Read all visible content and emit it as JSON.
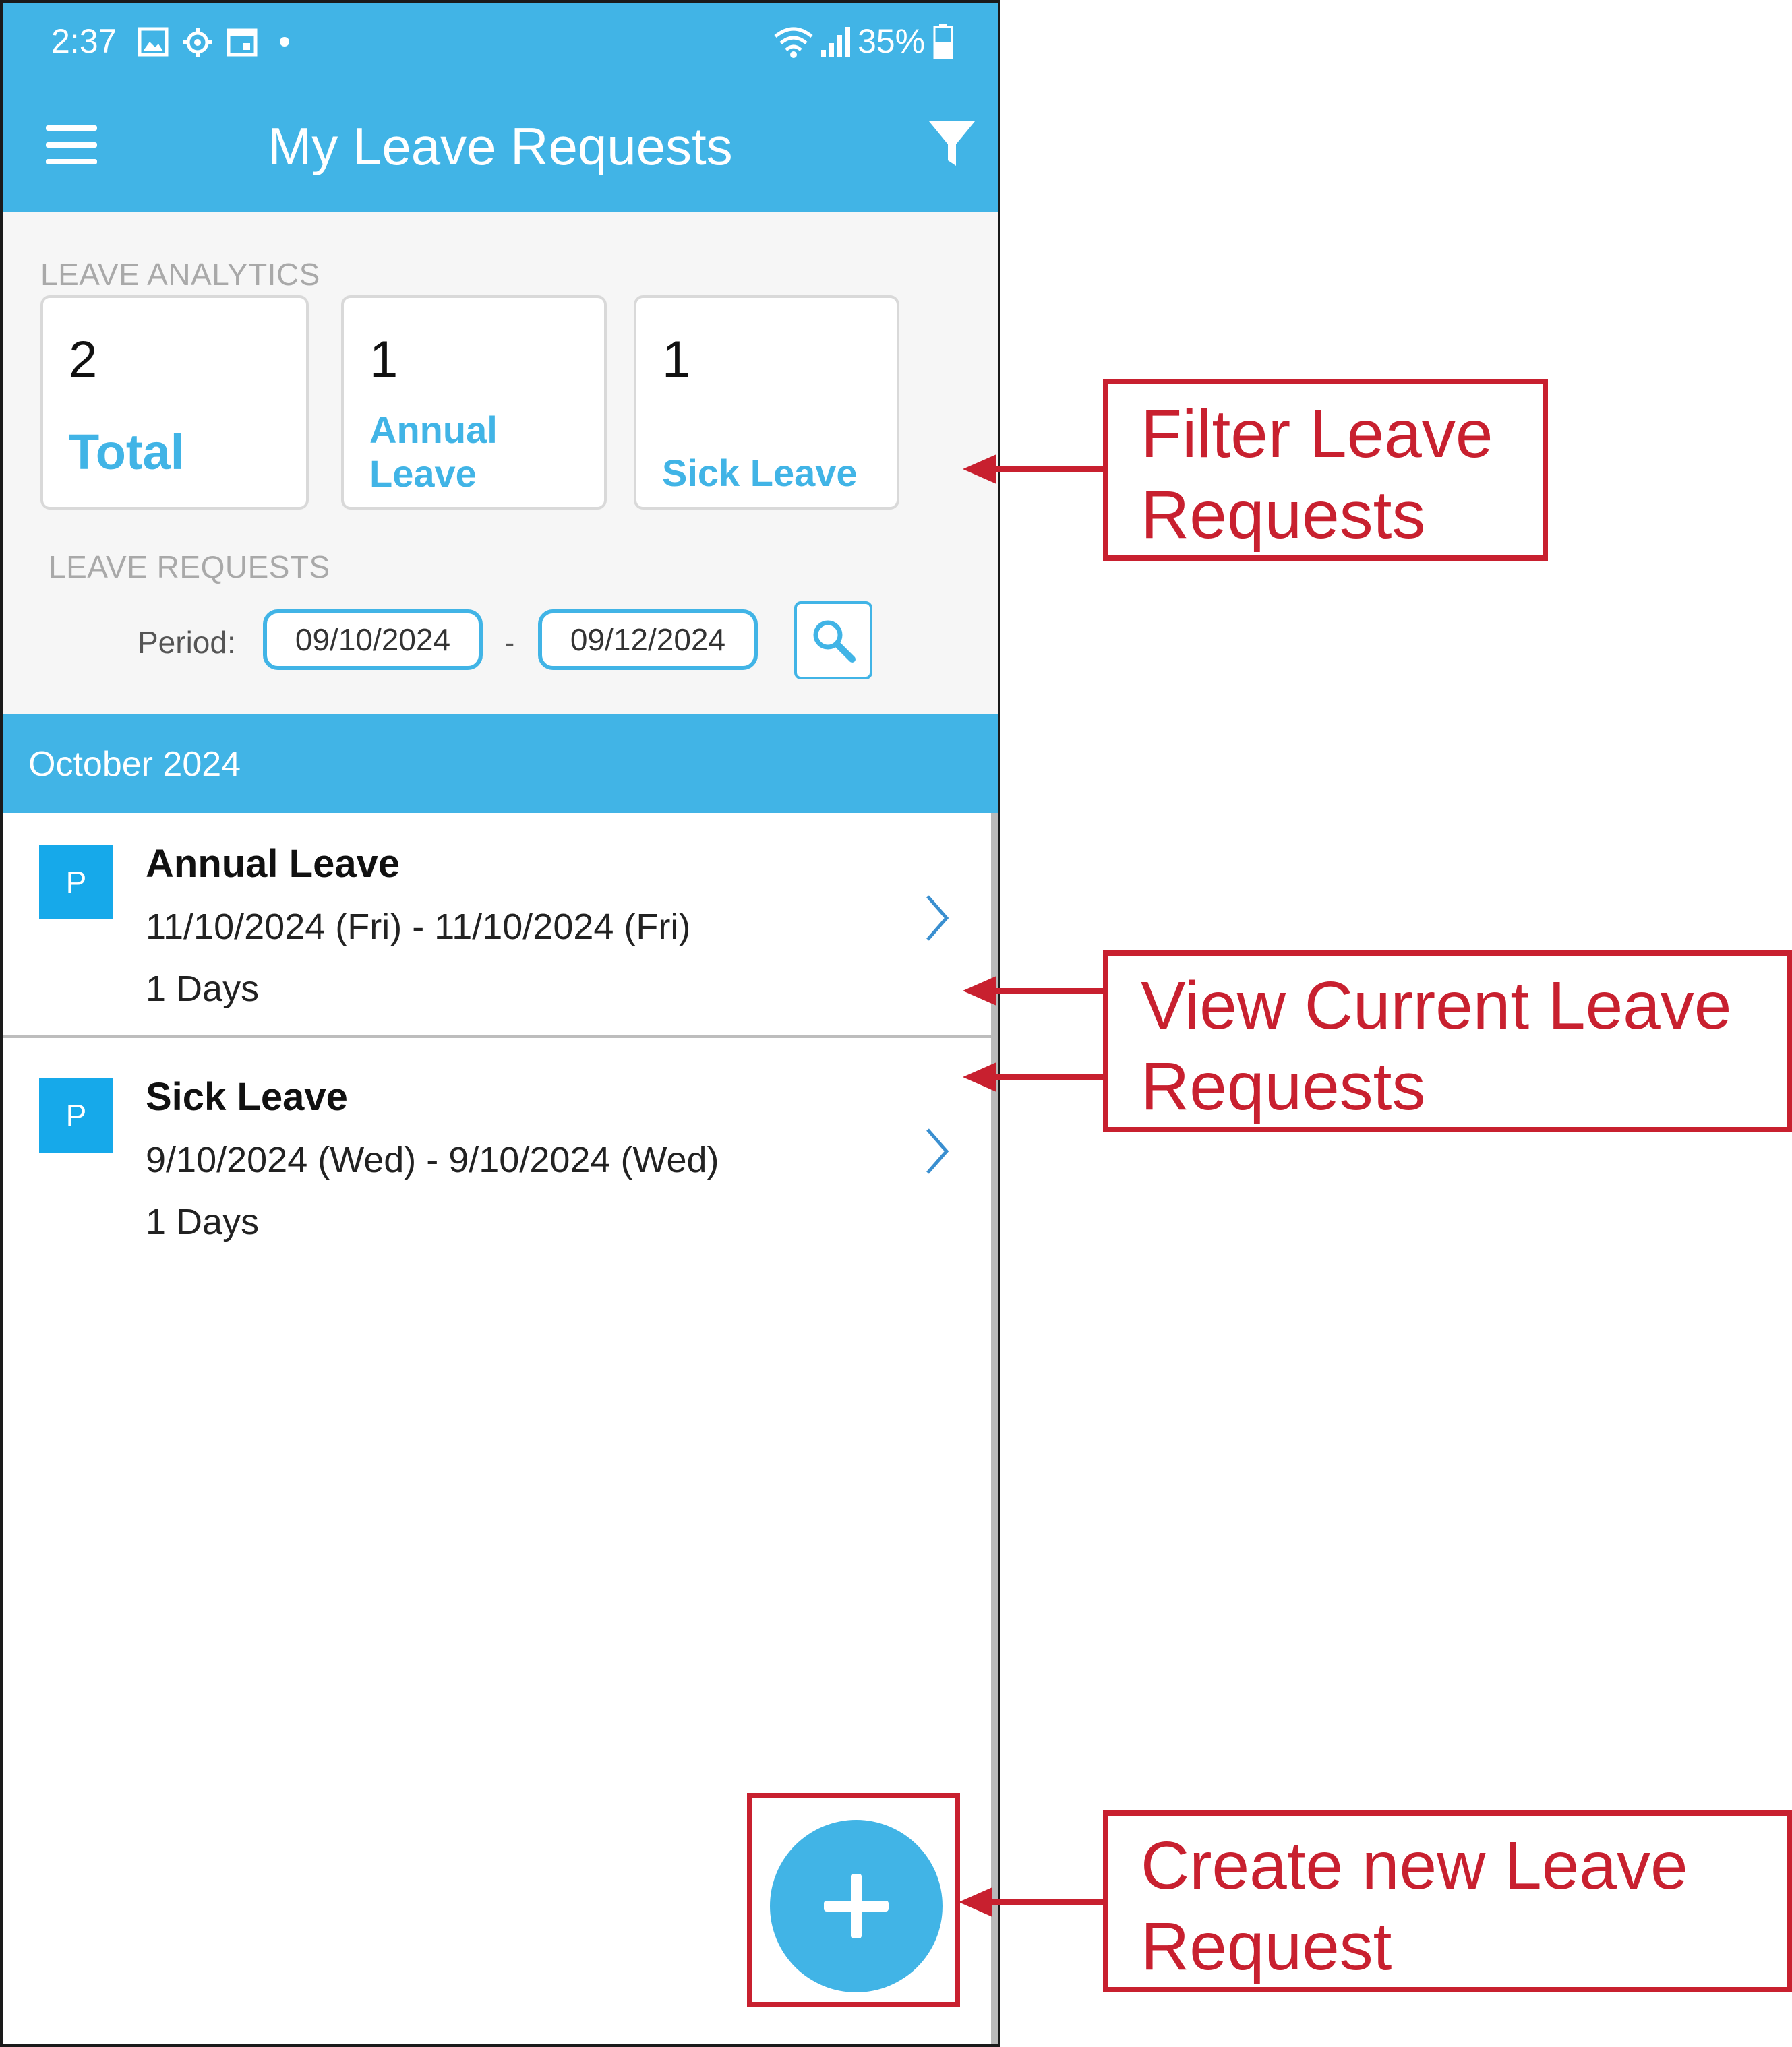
{
  "status_bar": {
    "time": "2:37",
    "battery_percent": "35%",
    "icons": [
      "gallery-icon",
      "settings-gear-icon",
      "calendar-icon",
      "notification-dot-icon",
      "wifi-icon",
      "signal-icon",
      "battery-icon"
    ]
  },
  "app_bar": {
    "title": "My Leave Requests",
    "menu_icon": "hamburger-menu-icon",
    "filter_icon": "filter-funnel-icon"
  },
  "analytics": {
    "section_label": "LEAVE ANALYTICS",
    "cards": [
      {
        "count": "2",
        "label": "Total"
      },
      {
        "count": "1",
        "label_line1": "Annual",
        "label_line2": "Leave"
      },
      {
        "count": "1",
        "label": "Sick Leave"
      }
    ]
  },
  "requests_filter": {
    "section_label": "LEAVE REQUESTS",
    "period_label": "Period:",
    "from_date": "09/10/2024",
    "separator": "-",
    "to_date": "09/12/2024",
    "search_icon": "search-magnifier-icon"
  },
  "month_header": "October 2024",
  "requests": [
    {
      "badge": "P",
      "type": "Annual Leave",
      "dates": "11/10/2024 (Fri) - 11/10/2024 (Fri)",
      "days": "1 Days"
    },
    {
      "badge": "P",
      "type": "Sick Leave",
      "dates": "9/10/2024 (Wed) - 9/10/2024 (Wed)",
      "days": "1 Days"
    }
  ],
  "fab": {
    "icon": "plus-icon"
  },
  "annotations": {
    "filter": {
      "line1": "Filter Leave",
      "line2": "Requests"
    },
    "view": {
      "line1": "View Current Leave",
      "line2": "Requests"
    },
    "create": {
      "line1": "Create new Leave",
      "line2": "Request"
    }
  },
  "colors": {
    "accent": "#41b4e6",
    "badge": "#16a9ea",
    "annotation": "#c8202f"
  }
}
